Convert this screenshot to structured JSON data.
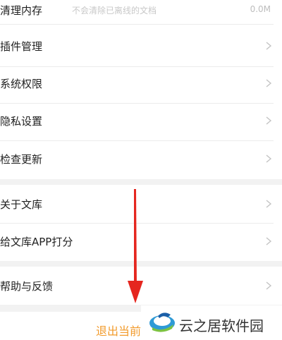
{
  "settings": {
    "clear_memory": {
      "label": "清理内存",
      "subtitle": "不会清除已离线的文档",
      "value": "0.0M"
    },
    "items_group1": [
      {
        "label": "插件管理"
      },
      {
        "label": "系统权限"
      },
      {
        "label": "隐私设置"
      },
      {
        "label": "检查更新"
      }
    ],
    "items_group2": [
      {
        "label": "关于文库"
      },
      {
        "label": "给文库APP打分"
      }
    ],
    "items_group3": [
      {
        "label": "帮助与反馈"
      }
    ],
    "logout_label": "退出当前",
    "icons": [
      "chevron-right-icon",
      "arrow-down-icon",
      "cloud-logo-icon"
    ]
  },
  "watermark": {
    "text": "云之居软件园"
  },
  "colors": {
    "accent": "#f29b2c",
    "arrow": "#e5261f",
    "background": "#f2f2f2"
  }
}
